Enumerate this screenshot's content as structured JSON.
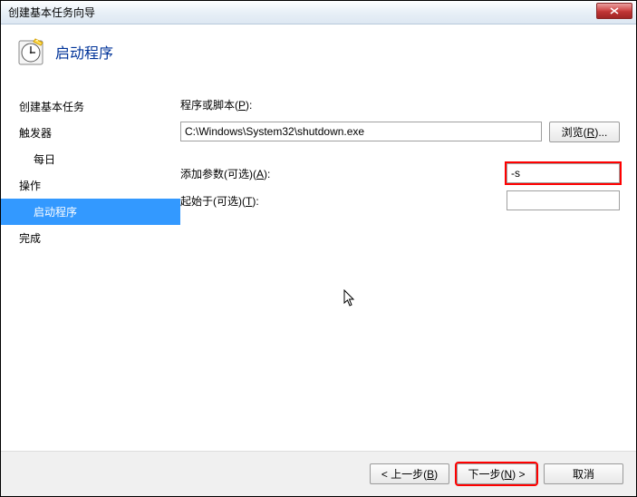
{
  "window": {
    "title": "创建基本任务向导"
  },
  "header": {
    "title": "启动程序"
  },
  "sidebar": {
    "item_basic": "创建基本任务",
    "item_trigger": "触发器",
    "item_daily": "每日",
    "item_action": "操作",
    "item_start_program": "启动程序",
    "item_finish": "完成"
  },
  "form": {
    "program_script_label": "程序或脚本(P):",
    "program_script_value": "C:\\Windows\\System32\\shutdown.exe",
    "browse_label": "浏览(R)...",
    "args_label": "添加参数(可选)(A):",
    "args_value": "-s",
    "startin_label": "起始于(可选)(T):",
    "startin_value": ""
  },
  "footer": {
    "back": "< 上一步(B)",
    "next": "下一步(N) >",
    "cancel": "取消"
  }
}
